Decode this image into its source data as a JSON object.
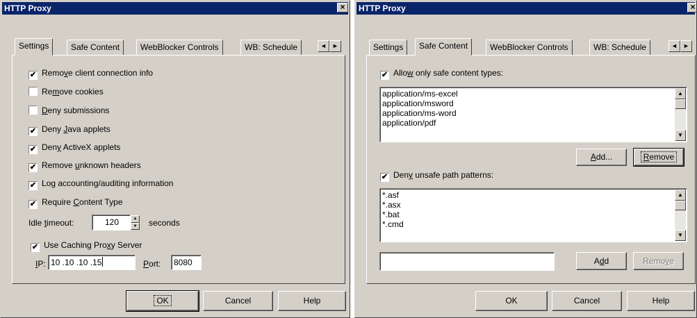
{
  "left_dialog": {
    "title": "HTTP Proxy",
    "close_label": "×",
    "tabs": [
      {
        "label": "Settings"
      },
      {
        "label": "Safe Content"
      },
      {
        "label": "WebBlocker Controls"
      },
      {
        "label": "WB: Schedule"
      }
    ],
    "tab_scroll_left": "◄",
    "tab_scroll_right": "►",
    "options": [
      {
        "pre": "Remo",
        "u": "v",
        "post": "e client connection info",
        "checked": true
      },
      {
        "pre": "Re",
        "u": "m",
        "post": "ove cookies",
        "checked": false
      },
      {
        "pre": "",
        "u": "D",
        "post": "eny submissions",
        "checked": false
      },
      {
        "pre": "Deny ",
        "u": "J",
        "post": "ava applets",
        "checked": true
      },
      {
        "pre": "Den",
        "u": "y",
        "post": " ActiveX applets",
        "checked": true
      },
      {
        "pre": "Remove ",
        "u": "u",
        "post": "nknown headers",
        "checked": true
      },
      {
        "pre": "Log accounting/auditing information",
        "u": "",
        "post": "",
        "checked": true
      },
      {
        "pre": "Require ",
        "u": "C",
        "post": "ontent Type",
        "checked": true
      }
    ],
    "idle_timeout": {
      "pre": "Idle ",
      "u": "t",
      "post": "imeout:",
      "value": "120",
      "unit": "seconds"
    },
    "caching_proxy": {
      "pre": "Use Caching Pro",
      "u": "x",
      "post": "y Server",
      "checked": true
    },
    "ip": {
      "u": "I",
      "post": "P:",
      "value": "10 .10 .10 .15"
    },
    "port": {
      "u": "P",
      "post": "ort:",
      "value": "8080"
    },
    "buttons": {
      "ok": "OK",
      "cancel": "Cancel",
      "help": "Help"
    }
  },
  "right_dialog": {
    "title": "HTTP Proxy",
    "close_label": "×",
    "tabs": [
      {
        "label": "Settings"
      },
      {
        "label": "Safe Content"
      },
      {
        "label": "WebBlocker Controls"
      },
      {
        "label": "WB: Schedule"
      }
    ],
    "tab_scroll_left": "◄",
    "tab_scroll_right": "►",
    "safe_types": {
      "pre": "Allo",
      "u": "w",
      "post": " only safe content types:",
      "checked": true,
      "items": [
        "application/ms-excel",
        "application/msword",
        "application/ms-word",
        "application/pdf"
      ],
      "add_u": "A",
      "add_post": "dd...",
      "remove_u": "R",
      "remove_post": "emove"
    },
    "unsafe_paths": {
      "pre": "Den",
      "u": "y",
      "post": " unsafe path patterns:",
      "checked": true,
      "items": [
        "*.asf",
        "*.asx",
        "*.bat",
        "*.cmd"
      ],
      "input_value": "",
      "add_pre": "A",
      "add_u": "d",
      "add_post": "d",
      "remove_pre": "Remo",
      "remove_u": "v",
      "remove_post": "e"
    },
    "buttons": {
      "ok": "OK",
      "cancel": "Cancel",
      "help": "Help"
    }
  },
  "glyphs": {
    "check": "✔",
    "spin_up": "▲",
    "spin_down": "▼",
    "scroll_up": "▲",
    "scroll_down": "▼"
  },
  "colors": {
    "titlebar": "#0a246a",
    "face": "#d4d0c8"
  }
}
